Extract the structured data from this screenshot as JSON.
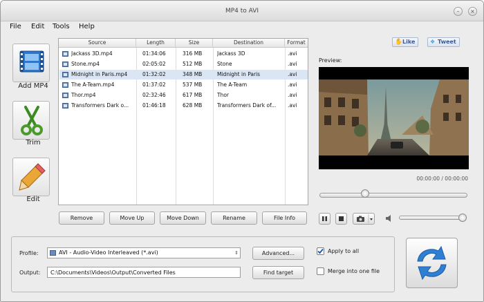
{
  "window": {
    "title": "MP4 to AVI"
  },
  "menu": [
    "File",
    "Edit",
    "Tools",
    "Help"
  ],
  "sidebar": {
    "add_label": "Add MP4",
    "trim_label": "Trim",
    "edit_label": "Edit"
  },
  "table": {
    "columns": [
      "Source",
      "Length",
      "Size",
      "Destination",
      "Format"
    ],
    "rows": [
      {
        "source": "Jackass 3D.mp4",
        "length": "01:34:06",
        "size": "316 MB",
        "destination": "Jackass 3D",
        "format": ".avi"
      },
      {
        "source": "Stone.mp4",
        "length": "02:05:02",
        "size": "512 MB",
        "destination": "Stone",
        "format": ".avi"
      },
      {
        "source": "Midnight in Paris.mp4",
        "length": "01:32:02",
        "size": "348 MB",
        "destination": "Midnight in Paris",
        "format": ".avi"
      },
      {
        "source": "The A-Team.mp4",
        "length": "01:37:02",
        "size": "537 MB",
        "destination": "The A-Team",
        "format": ".avi"
      },
      {
        "source": "Thor.mp4",
        "length": "02:32:46",
        "size": "617 MB",
        "destination": "Thor",
        "format": ".avi"
      },
      {
        "source": "Transformers Dark o...",
        "length": "01:46:18",
        "size": "628 MB",
        "destination": "Transformers Dark of...",
        "format": ".avi"
      }
    ],
    "selected_index": 2
  },
  "list_buttons": {
    "remove": "Remove",
    "move_up": "Move Up",
    "move_down": "Move Down",
    "rename": "Rename",
    "file_info": "File Info"
  },
  "social": {
    "like": "Like",
    "tweet": "Tweet"
  },
  "preview": {
    "label": "Preview:",
    "timecode": "00:00:00 / 00:00:00",
    "progress_fraction": 0.31,
    "volume_fraction": 0.96
  },
  "output": {
    "profile_label": "Profile:",
    "profile_value": "AVI - Audio-Video Interleaved (*.avi)",
    "output_label": "Output:",
    "output_path": "C:\\Documents\\Videos\\Output\\Converted Files",
    "advanced_button": "Advanced...",
    "find_target_button": "Find target",
    "apply_to_all": "Apply to all",
    "apply_to_all_checked": true,
    "merge_label": "Merge into one file",
    "merge_checked": false
  },
  "colors": {
    "selection": "#dbe6f4",
    "convert_blue": "#2f7fd2",
    "trim_green": "#4a9a2c",
    "edit_orange": "#e0a030"
  }
}
